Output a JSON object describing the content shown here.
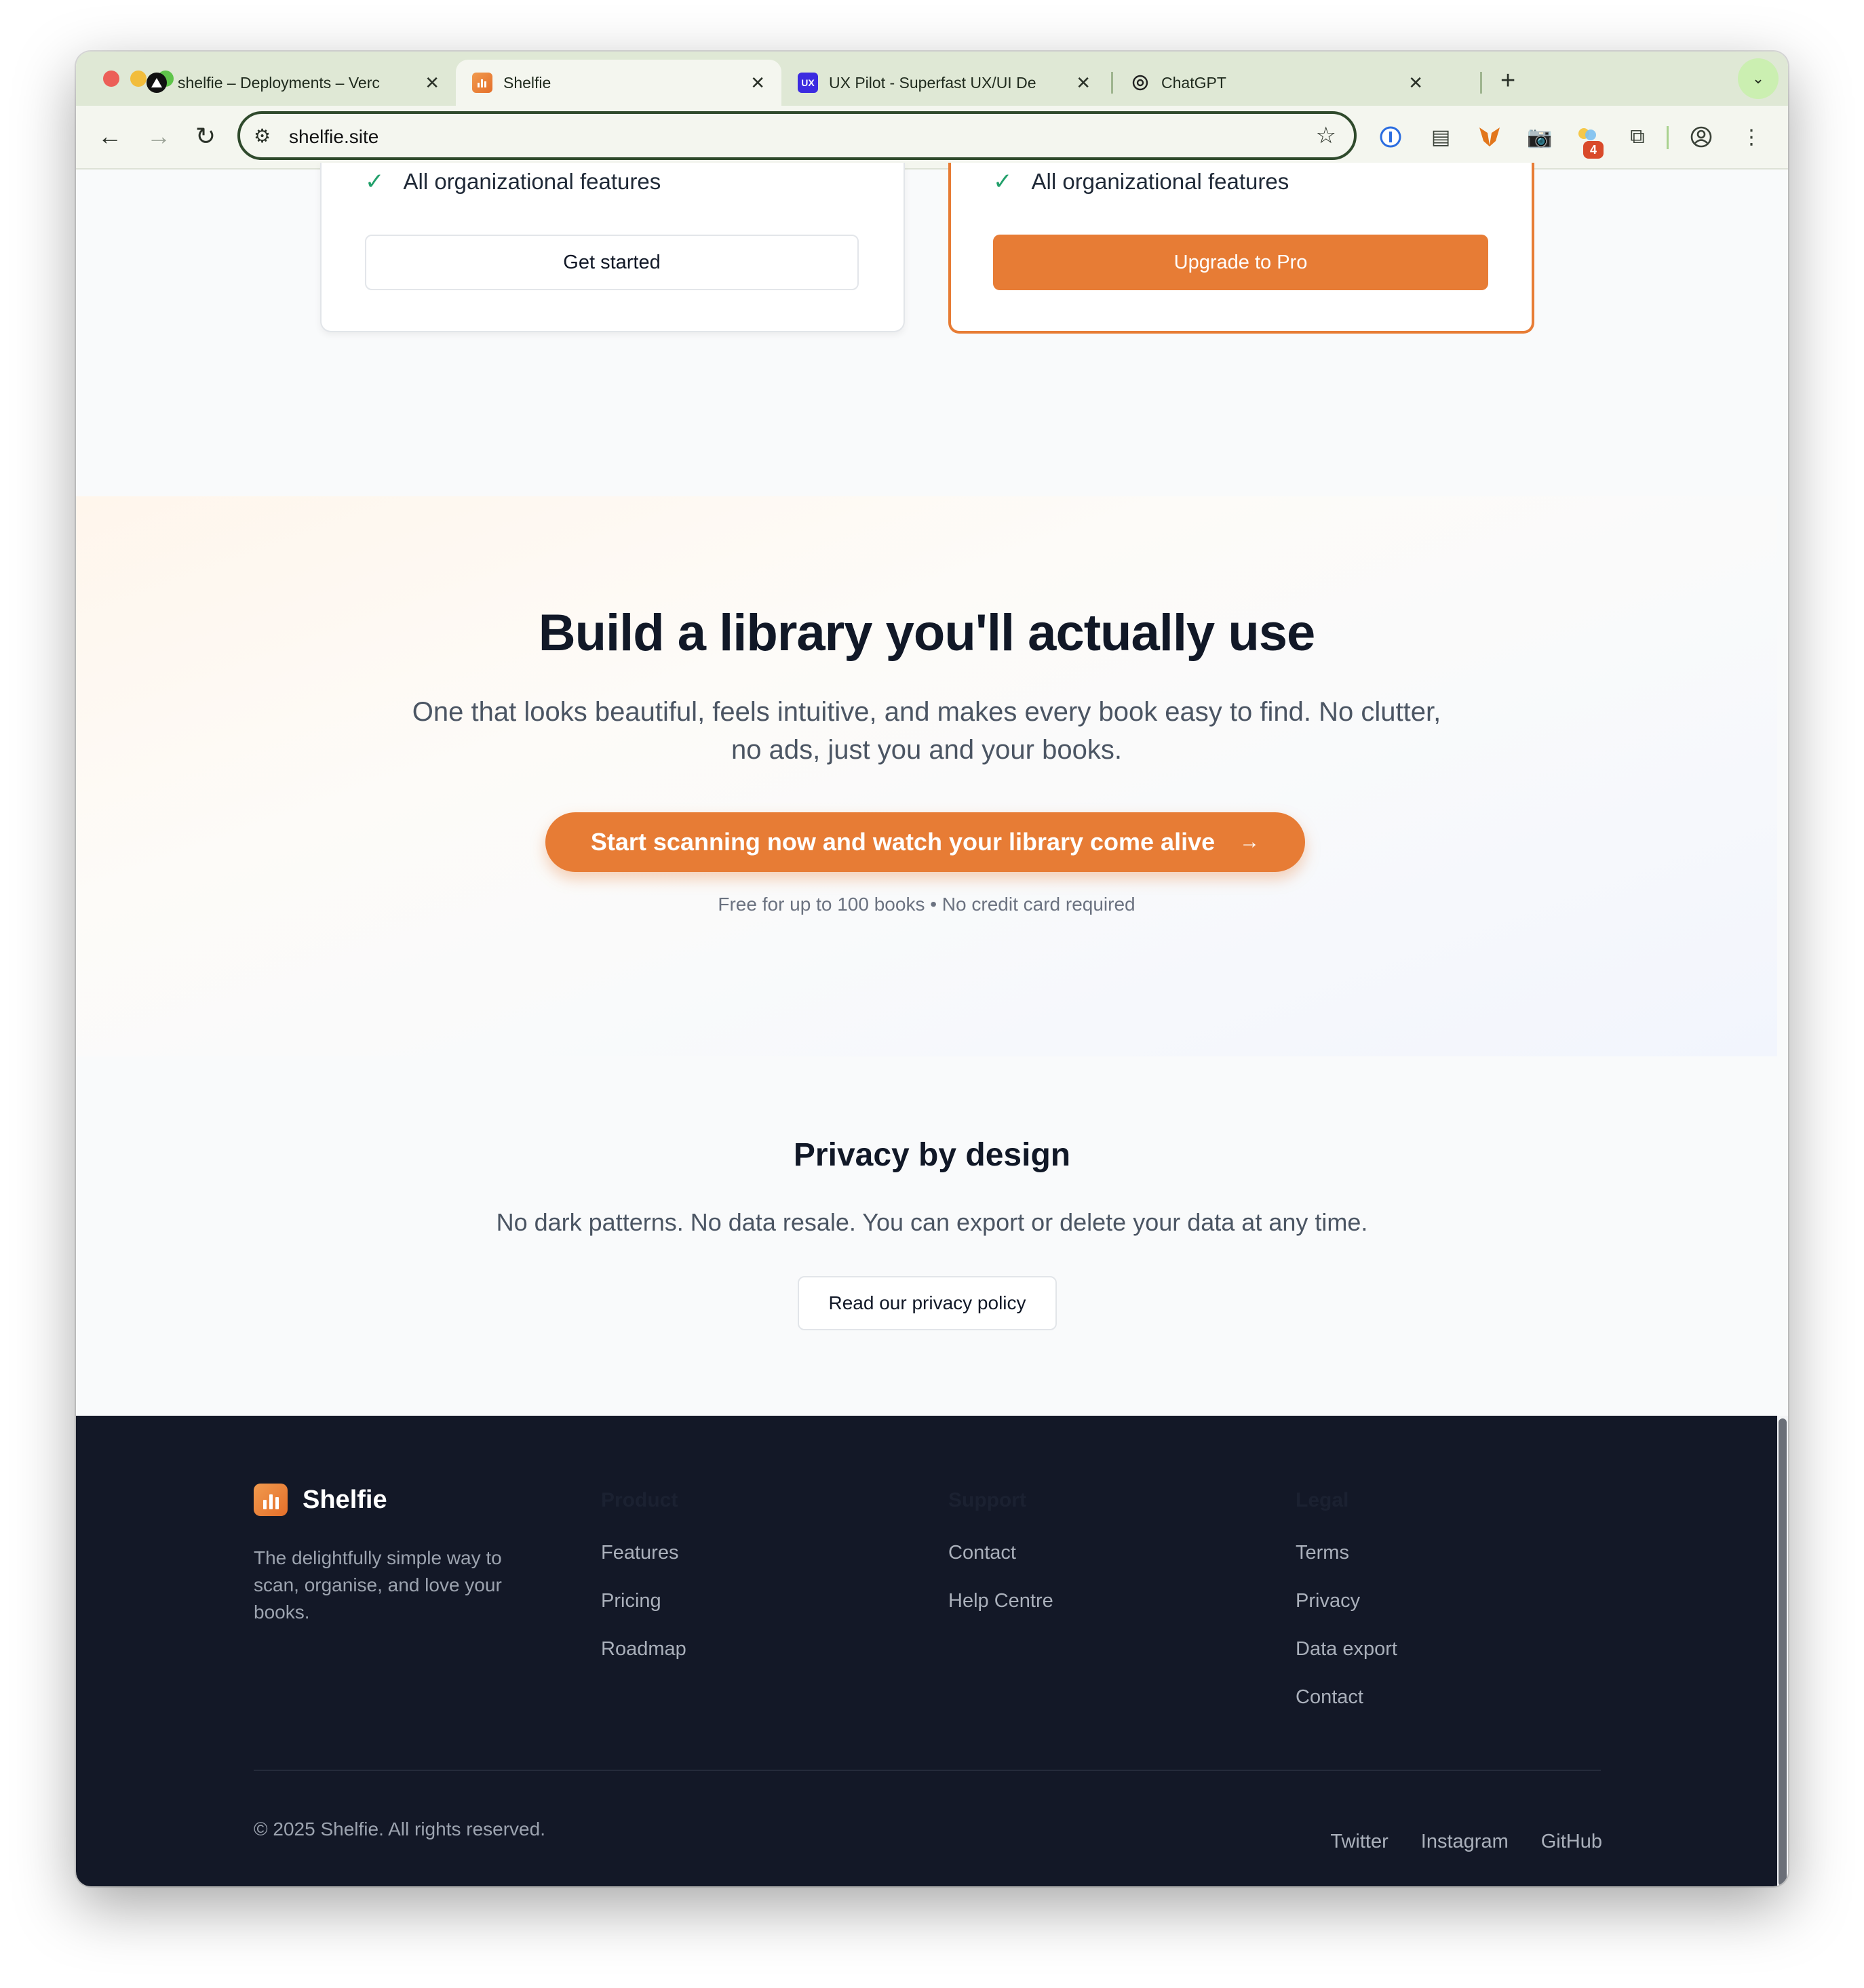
{
  "browser": {
    "tabs": [
      {
        "title": "shelfie – Deployments – Verc",
        "icon": "vercel-icon",
        "active": false
      },
      {
        "title": "Shelfie",
        "icon": "shelfie-icon",
        "active": true
      },
      {
        "title": "UX Pilot - Superfast UX/UI De",
        "icon": "ux-pilot-icon",
        "active": false
      },
      {
        "title": "ChatGPT",
        "icon": "chatgpt-icon",
        "active": false
      }
    ],
    "url": "shelfie.site",
    "extension_badge": "4"
  },
  "pricing": {
    "free": {
      "feature": "All organizational features",
      "button": "Get started"
    },
    "pro": {
      "feature": "All organizational features",
      "button": "Upgrade to Pro"
    }
  },
  "cta": {
    "title": "Build a library you'll actually use",
    "subtitle": "One that looks beautiful, feels intuitive, and makes every book easy to find. No clutter, no ads, just you and your books.",
    "button": "Start scanning now and watch your library come alive",
    "note": "Free for up to 100 books • No credit card required"
  },
  "privacy": {
    "title": "Privacy by design",
    "text": "No dark patterns. No data resale. You can export or delete your data at any time.",
    "button": "Read our privacy policy"
  },
  "footer": {
    "brand": "Shelfie",
    "description": "The delightfully simple way to scan, organise, and love your books.",
    "columns": {
      "product": {
        "heading": "Product",
        "links": [
          "Features",
          "Pricing",
          "Roadmap"
        ]
      },
      "support": {
        "heading": "Support",
        "links": [
          "Contact",
          "Help Centre"
        ]
      },
      "legal": {
        "heading": "Legal",
        "links": [
          "Terms",
          "Privacy",
          "Data export",
          "Contact"
        ]
      }
    },
    "copyright": "© 2025 Shelfie. All rights reserved.",
    "socials": [
      "Twitter",
      "Instagram",
      "GitHub"
    ]
  },
  "colors": {
    "accent": "#e77c35",
    "footer_bg": "#131827",
    "tabstrip_bg": "#dfe8d5"
  }
}
